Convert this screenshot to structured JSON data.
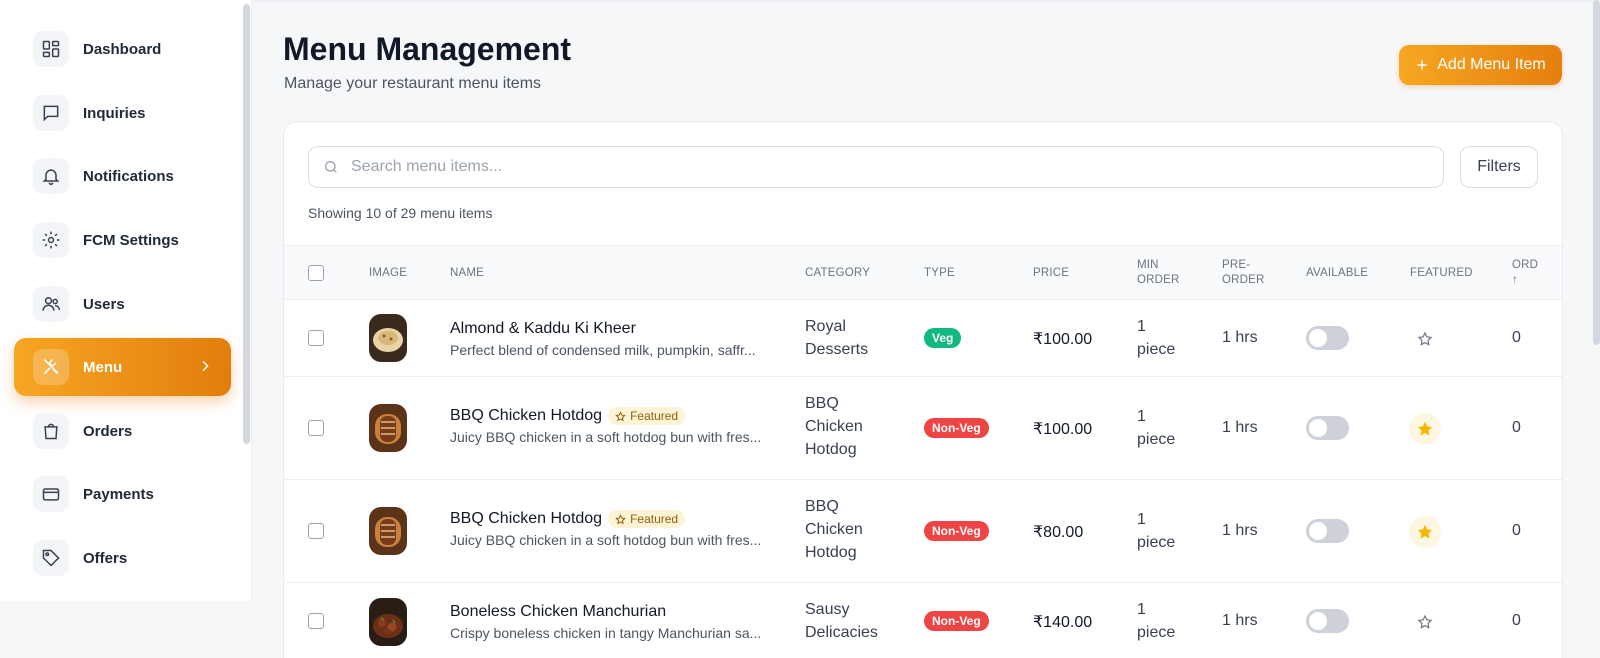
{
  "sidebar": {
    "items": [
      {
        "label": "Dashboard",
        "icon": "dashboard-icon"
      },
      {
        "label": "Inquiries",
        "icon": "chat-icon"
      },
      {
        "label": "Notifications",
        "icon": "bell-icon"
      },
      {
        "label": "FCM Settings",
        "icon": "gear-icon"
      },
      {
        "label": "Users",
        "icon": "users-icon"
      },
      {
        "label": "Menu",
        "icon": "utensils-icon",
        "active": true
      },
      {
        "label": "Orders",
        "icon": "bag-icon"
      },
      {
        "label": "Payments",
        "icon": "card-icon"
      },
      {
        "label": "Offers",
        "icon": "tag-icon"
      }
    ]
  },
  "header": {
    "title": "Menu Management",
    "subtitle": "Manage your restaurant menu items",
    "add_button": "Add Menu Item"
  },
  "search": {
    "placeholder": "Search menu items...",
    "filters_label": "Filters",
    "showing": "Showing 10 of 29 menu items"
  },
  "table": {
    "columns": {
      "image": "IMAGE",
      "name": "NAME",
      "category": "CATEGORY",
      "type": "TYPE",
      "price": "PRICE",
      "min_order_1": "MIN",
      "min_order_2": "ORDER",
      "pre_order_1": "PRE-",
      "pre_order_2": "ORDER",
      "available": "AVAILABLE",
      "featured": "FEATURED",
      "order_1": "ORD",
      "order_2": "↑"
    },
    "featured_badge": "Featured",
    "rows": [
      {
        "name": "Almond & Kaddu Ki Kheer",
        "description": "Perfect blend of condensed milk, pumpkin, saffr...",
        "category_lines": [
          "Royal",
          "Desserts"
        ],
        "type": "Veg",
        "price": "₹100.00",
        "min_order_lines": [
          "1",
          "piece"
        ],
        "pre_order": "1 hrs",
        "order": "0",
        "featured": false
      },
      {
        "name": "BBQ Chicken Hotdog",
        "description": "Juicy BBQ chicken in a soft hotdog bun with fres...",
        "category_lines": [
          "BBQ",
          "Chicken",
          "Hotdog"
        ],
        "type": "Non-Veg",
        "price": "₹100.00",
        "min_order_lines": [
          "1",
          "piece"
        ],
        "pre_order": "1 hrs",
        "order": "0",
        "featured": true
      },
      {
        "name": "BBQ Chicken Hotdog",
        "description": "Juicy BBQ chicken in a soft hotdog bun with fres...",
        "category_lines": [
          "BBQ",
          "Chicken",
          "Hotdog"
        ],
        "type": "Non-Veg",
        "price": "₹80.00",
        "min_order_lines": [
          "1",
          "piece"
        ],
        "pre_order": "1 hrs",
        "order": "0",
        "featured": true
      },
      {
        "name": "Boneless Chicken Manchurian",
        "description": "Crispy boneless chicken in tangy Manchurian sa...",
        "category_lines": [
          "Sausy",
          "Delicacies"
        ],
        "type": "Non-Veg",
        "price": "₹140.00",
        "min_order_lines": [
          "1",
          "piece"
        ],
        "pre_order": "1 hrs",
        "order": "0",
        "featured": false
      }
    ]
  },
  "colors": {
    "accent": "#f39a1c",
    "veg": "#10b981",
    "nonveg": "#ef4444",
    "star": "#f5b800"
  }
}
